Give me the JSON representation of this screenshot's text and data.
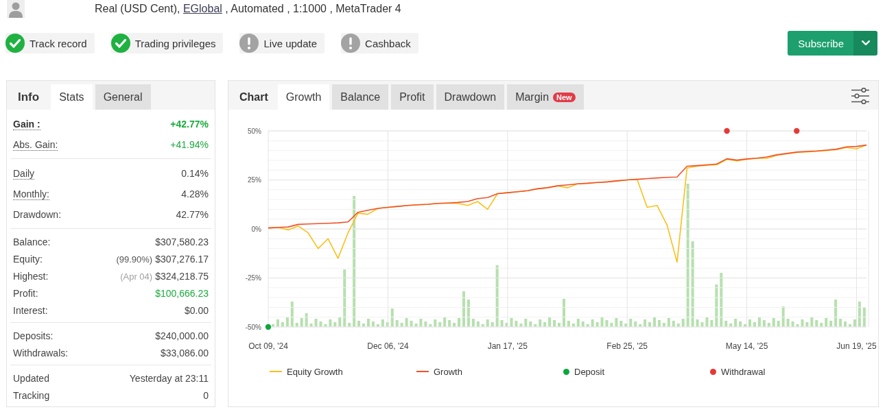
{
  "account": {
    "text": "Real (USD Cent),",
    "broker": "EGlobal",
    "details": ", Automated , 1:1000 , MetaTrader 4"
  },
  "badges": [
    {
      "label": "Track record",
      "verified": true
    },
    {
      "label": "Trading privileges",
      "verified": true
    },
    {
      "label": "Live update",
      "verified": false
    },
    {
      "label": "Cashback",
      "verified": false
    }
  ],
  "subscribe": {
    "label": "Subscribe"
  },
  "stats_panel": {
    "title": "Info",
    "tabs": [
      {
        "label": "Stats",
        "selected": true
      },
      {
        "label": "General",
        "selected": false
      }
    ],
    "sections": [
      {
        "rows": [
          {
            "label": "Gain :",
            "value": "+42.77%",
            "positive": true,
            "emphasis": true,
            "hint": true
          },
          {
            "label": "Abs. Gain:",
            "value": "+41.94%",
            "positive": true,
            "emphasis": false,
            "hint": true
          }
        ]
      },
      {
        "rows": [
          {
            "label": "Daily",
            "value": "0.14%",
            "positive": false,
            "emphasis": false,
            "hint": true
          },
          {
            "label": "Monthly:",
            "value": "4.28%",
            "positive": false,
            "emphasis": false,
            "hint": true
          },
          {
            "label": "Drawdown:",
            "value": "42.77%",
            "positive": false,
            "emphasis": false,
            "hint": false
          }
        ]
      },
      {
        "rows": [
          {
            "label": "Balance:",
            "value": "$307,580.23",
            "positive": false,
            "emphasis": false,
            "hint": false
          },
          {
            "label": "Equity:",
            "note": {
              "text": "(99.90%)",
              "muted": false
            },
            "value": "$307,276.17",
            "positive": false,
            "emphasis": false,
            "hint": false
          },
          {
            "label": "Highest:",
            "note": {
              "text": "(Apr 04)",
              "muted": true
            },
            "value": "$324,218.75",
            "positive": false,
            "emphasis": false,
            "hint": false
          },
          {
            "label": "Profit:",
            "value": "$100,666.23",
            "positive": true,
            "emphasis": false,
            "hint": false
          },
          {
            "label": "Interest:",
            "value": "$0.00",
            "positive": false,
            "emphasis": false,
            "hint": false
          }
        ]
      },
      {
        "rows": [
          {
            "label": "Deposits:",
            "value": "$240,000.00",
            "positive": false,
            "emphasis": false,
            "hint": false
          },
          {
            "label": "Withdrawals:",
            "value": "$33,086.00",
            "positive": false,
            "emphasis": false,
            "hint": false
          }
        ]
      },
      {
        "rows": [
          {
            "label": "Updated",
            "value": "Yesterday at 23:11",
            "positive": false,
            "emphasis": false,
            "hint": false
          },
          {
            "label": "Tracking",
            "value": "0",
            "positive": false,
            "emphasis": false,
            "hint": false
          }
        ]
      }
    ]
  },
  "chart_panel": {
    "title": "Chart",
    "tabs": [
      {
        "label": "Growth",
        "selected": true
      },
      {
        "label": "Balance",
        "selected": false
      },
      {
        "label": "Profit",
        "selected": false
      },
      {
        "label": "Drawdown",
        "selected": false
      },
      {
        "label": "Margin",
        "selected": false,
        "badge": "New"
      }
    ],
    "chart_data": {
      "type": "line",
      "grid": true,
      "legend": true,
      "categories": [
        "Oct 09, '24",
        null,
        null,
        null,
        null,
        null,
        null,
        null,
        null,
        null,
        null,
        null,
        "Dec 06, '24",
        null,
        null,
        null,
        null,
        null,
        null,
        null,
        null,
        null,
        null,
        null,
        "Jan 17, '25",
        null,
        null,
        null,
        null,
        null,
        null,
        null,
        null,
        null,
        null,
        null,
        "Feb 25, '25",
        null,
        null,
        null,
        null,
        null,
        null,
        null,
        null,
        null,
        null,
        null,
        "May 14, '25",
        null,
        null,
        null,
        null,
        null,
        null,
        null,
        null,
        null,
        null,
        "Jun 19, '25",
        null
      ],
      "ylim": [
        -50,
        50
      ],
      "yticks": [
        {
          "value": 50,
          "label": "50%"
        },
        {
          "value": 25,
          "label": "25%"
        },
        {
          "value": 0,
          "label": "0%"
        },
        {
          "value": -25,
          "label": "-25%"
        },
        {
          "value": -50,
          "label": "-50%"
        }
      ],
      "series": [
        {
          "name": "Equity Growth",
          "color": "#fbbf1a",
          "values": [
            0.5,
            0.8,
            -0.5,
            1.5,
            -2,
            -10,
            -5,
            -15,
            -2,
            8,
            7.5,
            10.5,
            11,
            11.5,
            12,
            12.3,
            12.5,
            13,
            13.2,
            13,
            12,
            14,
            10,
            18,
            18.5,
            19,
            19.5,
            20.5,
            21,
            22,
            21,
            23,
            23.3,
            23.7,
            24,
            24.5,
            25,
            25.3,
            11,
            12,
            2,
            -17,
            31,
            32,
            32.5,
            32.8,
            35.5,
            34.7,
            35.5,
            36,
            36,
            37.5,
            38.3,
            39,
            39.3,
            39.6,
            40,
            40.5,
            41.5,
            40.8,
            42.8
          ]
        },
        {
          "name": "Growth",
          "color": "#f0522a",
          "values": [
            0.5,
            0.8,
            1,
            2.3,
            2.5,
            2.7,
            2.9,
            3.1,
            3.6,
            8.5,
            9.5,
            10.5,
            11,
            11.5,
            12,
            12.3,
            12.6,
            13,
            13.2,
            13.5,
            14,
            15.5,
            16,
            18,
            18.5,
            19,
            19.5,
            20.5,
            21,
            22,
            22.5,
            23,
            23.3,
            23.7,
            24,
            24.5,
            25,
            25.3,
            25.7,
            26,
            26.3,
            26.5,
            32,
            32.3,
            32.7,
            33.1,
            35.8,
            35.1,
            35.7,
            36.1,
            36.7,
            37.8,
            38.5,
            39.2,
            39.5,
            39.8,
            40.2,
            40.7,
            41.9,
            42.1,
            42.8
          ]
        },
        {
          "name": "Deposit",
          "type": "scatter",
          "color": "#0ea63c",
          "values": [
            -50,
            null,
            null,
            null,
            null,
            null,
            null,
            null,
            null,
            null,
            null,
            null,
            null,
            null,
            null,
            null,
            null,
            null,
            null,
            null,
            null,
            null,
            null,
            null,
            null,
            null,
            null,
            null,
            null,
            null,
            null,
            null,
            null,
            null,
            null,
            null,
            null,
            null,
            null,
            null,
            null,
            null,
            null,
            null,
            null,
            null,
            null,
            null,
            null,
            null,
            null,
            null,
            null,
            null,
            null,
            null,
            null,
            null,
            null,
            null,
            null
          ]
        },
        {
          "name": "Withdrawal",
          "type": "scatter",
          "color": "#e53935",
          "values": [
            null,
            null,
            null,
            null,
            null,
            null,
            null,
            null,
            null,
            null,
            null,
            null,
            null,
            null,
            null,
            null,
            null,
            null,
            null,
            null,
            null,
            null,
            null,
            null,
            null,
            null,
            null,
            null,
            null,
            null,
            null,
            null,
            null,
            null,
            null,
            null,
            null,
            null,
            null,
            null,
            null,
            null,
            null,
            null,
            null,
            null,
            50,
            null,
            null,
            null,
            null,
            null,
            null,
            50,
            null,
            null,
            null,
            null,
            null,
            null,
            null
          ]
        }
      ]
    }
  }
}
